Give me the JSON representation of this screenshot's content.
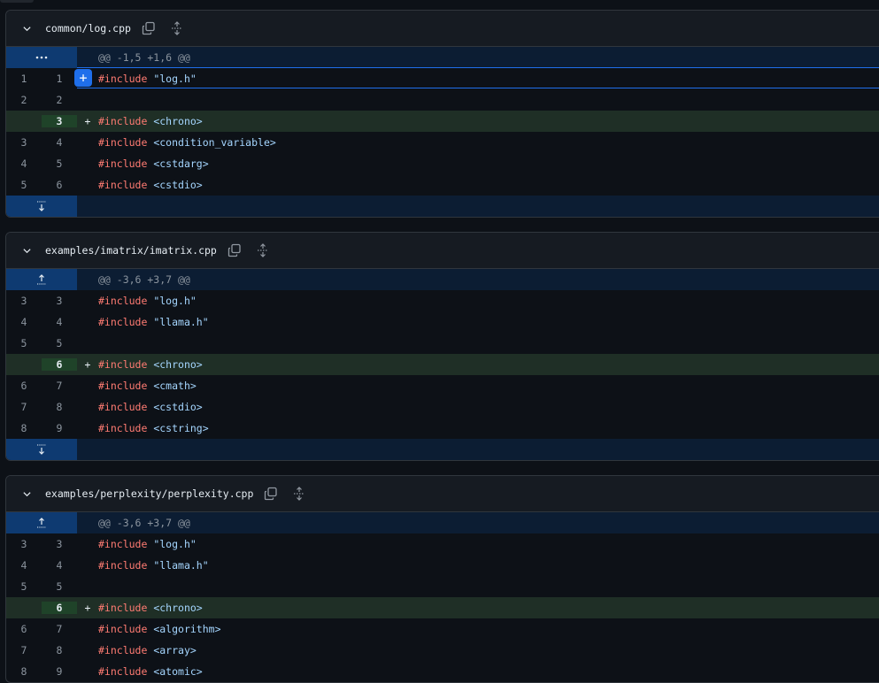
{
  "files": [
    {
      "name": "common/log.cpp",
      "hunk": "@@ -1,5 +1,6 @@",
      "hunk_gutter_icon": "ellipsis-icon",
      "lines": [
        {
          "old": "1",
          "new": "1",
          "sign": "",
          "type": "ctx",
          "directive": "#include",
          "target": "\"log.h\"",
          "target_kind": "str",
          "highlighted": true
        },
        {
          "old": "2",
          "new": "2",
          "sign": "",
          "type": "ctx",
          "directive": "",
          "target": "",
          "target_kind": ""
        },
        {
          "old": "",
          "new": "3",
          "sign": "+",
          "type": "add",
          "directive": "#include",
          "target": "<chrono>",
          "target_kind": "ang"
        },
        {
          "old": "3",
          "new": "4",
          "sign": "",
          "type": "ctx",
          "directive": "#include",
          "target": "<condition_variable>",
          "target_kind": "ang"
        },
        {
          "old": "4",
          "new": "5",
          "sign": "",
          "type": "ctx",
          "directive": "#include",
          "target": "<cstdarg>",
          "target_kind": "ang"
        },
        {
          "old": "5",
          "new": "6",
          "sign": "",
          "type": "ctx",
          "directive": "#include",
          "target": "<cstdio>",
          "target_kind": "ang"
        }
      ],
      "add_comment_label": "+"
    },
    {
      "name": "examples/imatrix/imatrix.cpp",
      "hunk": "@@ -3,6 +3,7 @@",
      "hunk_gutter_icon": "expand-up-icon",
      "lines": [
        {
          "old": "3",
          "new": "3",
          "sign": "",
          "type": "ctx",
          "directive": "#include",
          "target": "\"log.h\"",
          "target_kind": "str"
        },
        {
          "old": "4",
          "new": "4",
          "sign": "",
          "type": "ctx",
          "directive": "#include",
          "target": "\"llama.h\"",
          "target_kind": "str"
        },
        {
          "old": "5",
          "new": "5",
          "sign": "",
          "type": "ctx",
          "directive": "",
          "target": "",
          "target_kind": ""
        },
        {
          "old": "",
          "new": "6",
          "sign": "+",
          "type": "add",
          "directive": "#include",
          "target": "<chrono>",
          "target_kind": "ang"
        },
        {
          "old": "6",
          "new": "7",
          "sign": "",
          "type": "ctx",
          "directive": "#include",
          "target": "<cmath>",
          "target_kind": "ang"
        },
        {
          "old": "7",
          "new": "8",
          "sign": "",
          "type": "ctx",
          "directive": "#include",
          "target": "<cstdio>",
          "target_kind": "ang"
        },
        {
          "old": "8",
          "new": "9",
          "sign": "",
          "type": "ctx",
          "directive": "#include",
          "target": "<cstring>",
          "target_kind": "ang"
        }
      ]
    },
    {
      "name": "examples/perplexity/perplexity.cpp",
      "hunk": "@@ -3,6 +3,7 @@",
      "hunk_gutter_icon": "expand-up-icon",
      "lines": [
        {
          "old": "3",
          "new": "3",
          "sign": "",
          "type": "ctx",
          "directive": "#include",
          "target": "\"log.h\"",
          "target_kind": "str"
        },
        {
          "old": "4",
          "new": "4",
          "sign": "",
          "type": "ctx",
          "directive": "#include",
          "target": "\"llama.h\"",
          "target_kind": "str"
        },
        {
          "old": "5",
          "new": "5",
          "sign": "",
          "type": "ctx",
          "directive": "",
          "target": "",
          "target_kind": ""
        },
        {
          "old": "",
          "new": "6",
          "sign": "+",
          "type": "add",
          "directive": "#include",
          "target": "<chrono>",
          "target_kind": "ang"
        },
        {
          "old": "6",
          "new": "7",
          "sign": "",
          "type": "ctx",
          "directive": "#include",
          "target": "<algorithm>",
          "target_kind": "ang"
        },
        {
          "old": "7",
          "new": "8",
          "sign": "",
          "type": "ctx",
          "directive": "#include",
          "target": "<array>",
          "target_kind": "ang"
        },
        {
          "old": "8",
          "new": "9",
          "sign": "",
          "type": "ctx",
          "directive": "#include",
          "target": "<atomic>",
          "target_kind": "ang"
        }
      ]
    }
  ],
  "colors": {
    "background": "#0d1117",
    "header": "#161b22",
    "hunk": "#0c1d33",
    "hunk_gutter": "#0e3a71",
    "addition": "#1f2f26",
    "addition_gutter": "#1f4329",
    "keyword": "#ff7b72",
    "string": "#a5d6ff",
    "accent": "#1f6feb"
  }
}
